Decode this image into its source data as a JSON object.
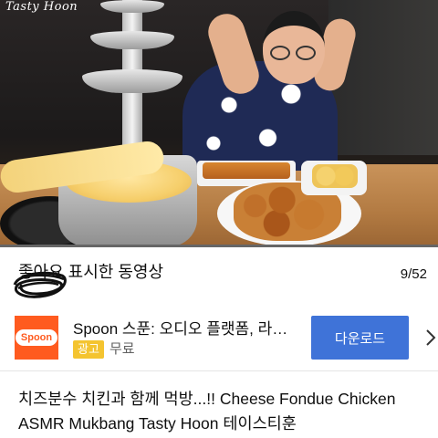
{
  "video": {
    "watermark": "Tasty Hoon",
    "progress_fraction": 0.0
  },
  "playlist": {
    "title": "좋아요 표시한 동영상",
    "position": "9/52"
  },
  "ad": {
    "logo_text": "Spoon",
    "title": "Spoon 스푼: 오디오 플랫폼, 라이브 방송",
    "badge": "광고",
    "price": "무료",
    "button": "다운로드",
    "colors": {
      "logo_bg": "#ff5b1f",
      "button_bg": "#3f73d8",
      "badge_bg": "#f4c430"
    }
  },
  "video_title": "치즈분수 치킨과 함께 먹방...!! Cheese Fondue Chicken ASMR Mukbang Tasty Hoon 테이스티훈"
}
